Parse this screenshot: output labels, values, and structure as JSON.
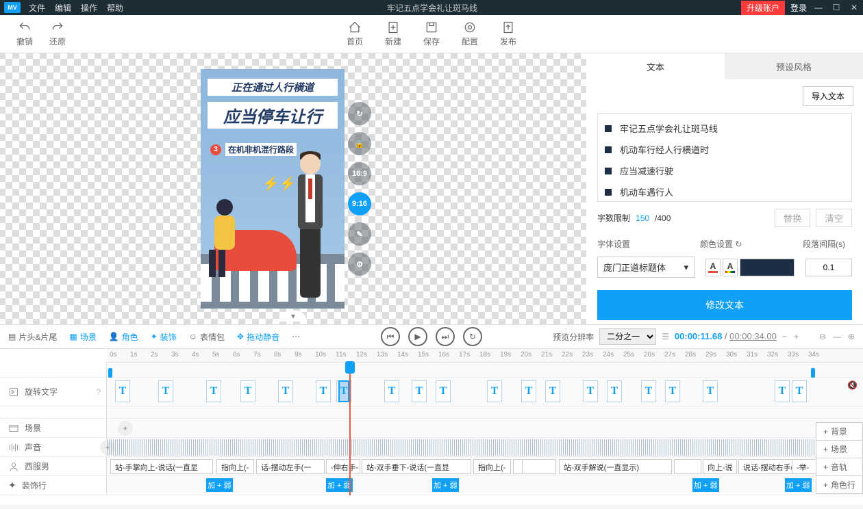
{
  "titlebar": {
    "logo": "MV",
    "menus": [
      "文件",
      "编辑",
      "操作",
      "帮助"
    ],
    "title": "牢记五点学会礼让斑马线",
    "upgrade": "升级账户",
    "login": "登录"
  },
  "toolbar": {
    "undo": "撤销",
    "redo": "还原",
    "home": "首页",
    "new": "新建",
    "save": "保存",
    "config": "配置",
    "publish": "发布"
  },
  "canvas": {
    "text1": "正在通过人行横道",
    "text2": "应当停车让行",
    "section_num": "3",
    "section_label": "在机非机混行路段"
  },
  "canvas_tools": {
    "ratio1": "16:9",
    "ratio2": "9:16"
  },
  "panel": {
    "tabs": {
      "text": "文本",
      "preset": "预设风格"
    },
    "import": "导入文本",
    "items": [
      "牢记五点学会礼让斑马线",
      "机动车行经人行横道时",
      "应当减速行驶",
      "机动车遇行人"
    ],
    "count_label": "字数限制",
    "count_cur": "150",
    "count_sep": " /400",
    "replace": "替换",
    "clear": "清空",
    "font_label": "字体设置",
    "color_label": "颜色设置",
    "gap_label": "段落间隔(s)",
    "font_value": "庞门正道标题体",
    "gap_value": "0.1",
    "modify": "修改文本"
  },
  "controls": {
    "items": [
      "片头&片尾",
      "场景",
      "角色",
      "装饰",
      "表情包",
      "拖动静音"
    ],
    "preview_label": "预览分辨率",
    "preview_value": "二分之一",
    "time_cur": "00:00:11.68",
    "time_sep": " / ",
    "time_tot": "00:00:34.00"
  },
  "timeline": {
    "ticks": [
      "0s",
      "1s",
      "2s",
      "3s",
      "4s",
      "5s",
      "6s",
      "7s",
      "8s",
      "9s",
      "10s",
      "11s",
      "12s",
      "13s",
      "14s",
      "15s",
      "16s",
      "17s",
      "18s",
      "19s",
      "20s",
      "21s",
      "22s",
      "23s",
      "24s",
      "25s",
      "26s",
      "27s",
      "28s",
      "29s",
      "30s",
      "31s",
      "32s",
      "33s",
      "34s"
    ],
    "tracks": {
      "text": "旋转文字",
      "scene": "场景",
      "audio": "声音",
      "char": "西服男",
      "deco": "装饰行"
    },
    "char_clips": [
      "站-手掌向上-说话(一直显",
      "指向上(-",
      "话-摆动左手(一",
      "-伸右手-",
      "站-双手垂下-说话(一直显",
      "指向上(-",
      "",
      "",
      "站-双手解说(一直显示)",
      "",
      "向上-说",
      "说话-摆动右手(一",
      "-举-"
    ],
    "deco_label": "加 + 弱",
    "side": [
      "背景",
      "场景",
      "音轨",
      "角色行"
    ]
  }
}
